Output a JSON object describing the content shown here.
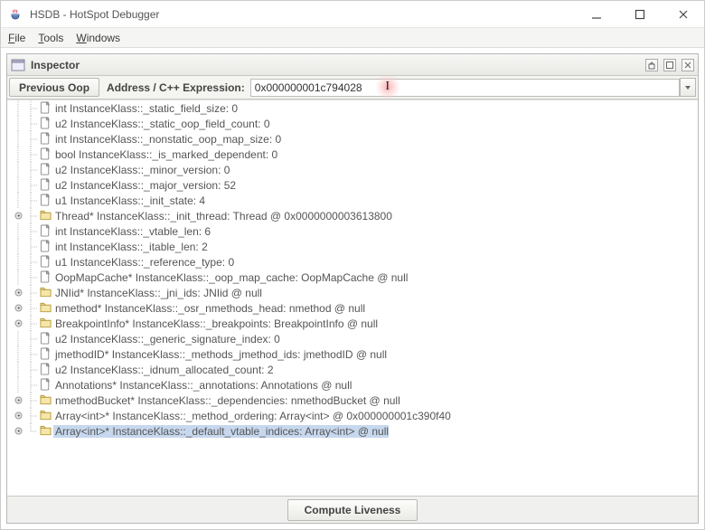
{
  "window": {
    "title": "HSDB - HotSpot Debugger"
  },
  "menu": {
    "file": "File",
    "tools": "Tools",
    "windows": "Windows"
  },
  "inspector": {
    "title": "Inspector",
    "prev_label": "Previous Oop",
    "addr_label": "Address / C++ Expression:",
    "addr_value": "0x000000001c794028"
  },
  "footer": {
    "compute_label": "Compute Liveness"
  },
  "tree": {
    "rows": [
      {
        "toggle": "none",
        "icon": "file",
        "text": "int InstanceKlass::_static_field_size: 0"
      },
      {
        "toggle": "none",
        "icon": "file",
        "text": "u2 InstanceKlass::_static_oop_field_count: 0"
      },
      {
        "toggle": "none",
        "icon": "file",
        "text": "int InstanceKlass::_nonstatic_oop_map_size: 0"
      },
      {
        "toggle": "none",
        "icon": "file",
        "text": "bool InstanceKlass::_is_marked_dependent: 0"
      },
      {
        "toggle": "none",
        "icon": "file",
        "text": "u2 InstanceKlass::_minor_version: 0"
      },
      {
        "toggle": "none",
        "icon": "file",
        "text": "u2 InstanceKlass::_major_version: 52"
      },
      {
        "toggle": "none",
        "icon": "file",
        "text": "u1 InstanceKlass::_init_state: 4"
      },
      {
        "toggle": "closed",
        "icon": "folder",
        "text": "Thread* InstanceKlass::_init_thread: Thread @ 0x0000000003613800"
      },
      {
        "toggle": "none",
        "icon": "file",
        "text": "int InstanceKlass::_vtable_len: 6"
      },
      {
        "toggle": "none",
        "icon": "file",
        "text": "int InstanceKlass::_itable_len: 2"
      },
      {
        "toggle": "none",
        "icon": "file",
        "text": "u1 InstanceKlass::_reference_type: 0"
      },
      {
        "toggle": "none",
        "icon": "file",
        "text": "OopMapCache* InstanceKlass::_oop_map_cache: OopMapCache @ null"
      },
      {
        "toggle": "closed",
        "icon": "folder",
        "text": "JNIid* InstanceKlass::_jni_ids: JNIid @ null"
      },
      {
        "toggle": "closed",
        "icon": "folder",
        "text": "nmethod* InstanceKlass::_osr_nmethods_head: nmethod @ null"
      },
      {
        "toggle": "closed",
        "icon": "folder",
        "text": "BreakpointInfo* InstanceKlass::_breakpoints: BreakpointInfo @ null"
      },
      {
        "toggle": "none",
        "icon": "file",
        "text": "u2 InstanceKlass::_generic_signature_index: 0"
      },
      {
        "toggle": "none",
        "icon": "file",
        "text": "jmethodID* InstanceKlass::_methods_jmethod_ids: jmethodID @ null"
      },
      {
        "toggle": "none",
        "icon": "file",
        "text": "u2 InstanceKlass::_idnum_allocated_count: 2"
      },
      {
        "toggle": "none",
        "icon": "file",
        "text": "Annotations* InstanceKlass::_annotations: Annotations @ null"
      },
      {
        "toggle": "closed",
        "icon": "folder",
        "text": "nmethodBucket* InstanceKlass::_dependencies: nmethodBucket @ null"
      },
      {
        "toggle": "closed",
        "icon": "folder",
        "text": "Array<int>* InstanceKlass::_method_ordering: Array<int> @ 0x000000001c390f40"
      },
      {
        "toggle": "closed",
        "icon": "folder",
        "text": "Array<int>* InstanceKlass::_default_vtable_indices: Array<int> @ null",
        "selected": true
      }
    ]
  }
}
